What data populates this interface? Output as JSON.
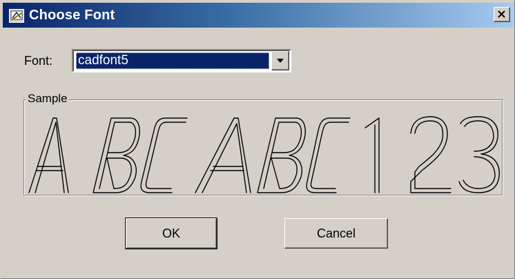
{
  "window": {
    "title": "Choose Font",
    "icon": "font-dialog-icon",
    "close_icon": "close-icon"
  },
  "font_field": {
    "label": "Font:",
    "selected_value": "cadfont5",
    "dropdown_icon": "chevron-down-icon"
  },
  "sample": {
    "group_label": "Sample",
    "text": "ABCABC123"
  },
  "buttons": {
    "ok_label": "OK",
    "cancel_label": "Cancel"
  },
  "colors": {
    "titlebar_start": "#0a246a",
    "titlebar_end": "#a6caf0",
    "dialog_background": "#d4d0c8",
    "selection_background": "#0a246a"
  }
}
